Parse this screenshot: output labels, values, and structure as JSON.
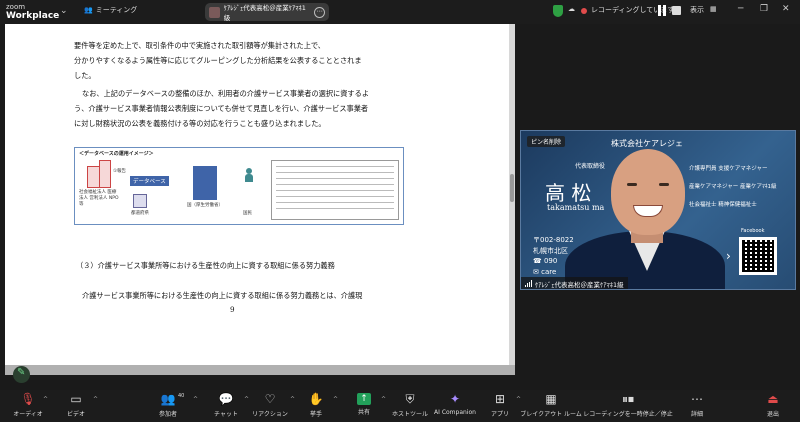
{
  "window": {
    "logo_line1": "zoom",
    "logo_line2": "Workplace",
    "meeting_label": "ミーティング",
    "pill_title": "ｹｱﾚｼﾞｪ代表高松＠産業ｹｱﾏﾈ1級",
    "recording_status": "レコーディングしています...",
    "view_label": "表示"
  },
  "document": {
    "line1": "要件等を定めた上で、取引条件の中で実施された取引額等が集計された上で、",
    "line2": "分かりやすくなるよう属性等に応じてグルーピングした分析結果を公表することとされま",
    "line3": "した。",
    "para2_l1": "なお、上記のデータベースの整備のほか、利用者の介護サービス事業者の選択に資するよ",
    "para2_l2": "う、介護サービス事業者情報公表制度についても併せて見直しを行い、介護サービス事業者",
    "para2_l3": "に対し財務状況の公表を義務付ける等の対応を行うことも盛り込まれました。",
    "diagram_title": "＜データベースの運用イメージ＞",
    "diagram_db_label": "データベース",
    "diagram_left_labels": "社会福祉法人 医療法人 営利法人 NPO 等",
    "diagram_report": "①報告",
    "diagram_kokumin": "国民",
    "diagram_kuni": "国（厚生労働省）",
    "diagram_pref": "都道府県",
    "section_heading": "（３）介護サービス事業所等における生産性の向上に資する取組に係る努力義務",
    "body_line": "介護サービス事業所等における生産性の向上に資する取組に係る努力義務とは、介護現",
    "page_number": "9"
  },
  "video": {
    "pin_label": "ピン名削除",
    "company": "株式会社ケアレジェ",
    "rep_label": "代表取締役",
    "name_kanji": "高 松",
    "name_roman": "takamatsu ma",
    "titles_1": "介護専門員 支援ケアマネジャー",
    "titles_2": "産業ケアマネジャー 産業ケアﾏﾈ1級",
    "titles_3": "社会福祉士 精神保健福祉士",
    "postal": "〒002-8022",
    "address": "札幌市北区",
    "phone": "☎ 090",
    "email": "✉ care",
    "facebook": "Facebook",
    "participant_name": "ｹｱﾚｼﾞｪ代表高松＠産業ｹｱﾏﾈ1級"
  },
  "toolbar": {
    "audio": "オーディオ",
    "video": "ビデオ",
    "participants": "参加者",
    "participants_count": "40",
    "chat": "チャット",
    "reactions": "リアクション",
    "raise_hand": "挙手",
    "share": "共有",
    "host_tools": "ホストツール",
    "ai_companion": "AI Companion",
    "apps": "アプリ",
    "breakout": "ブレイクアウト ルーム",
    "recording": "レコーディングを一時停止／停止",
    "details": "詳細",
    "leave": "退出"
  }
}
